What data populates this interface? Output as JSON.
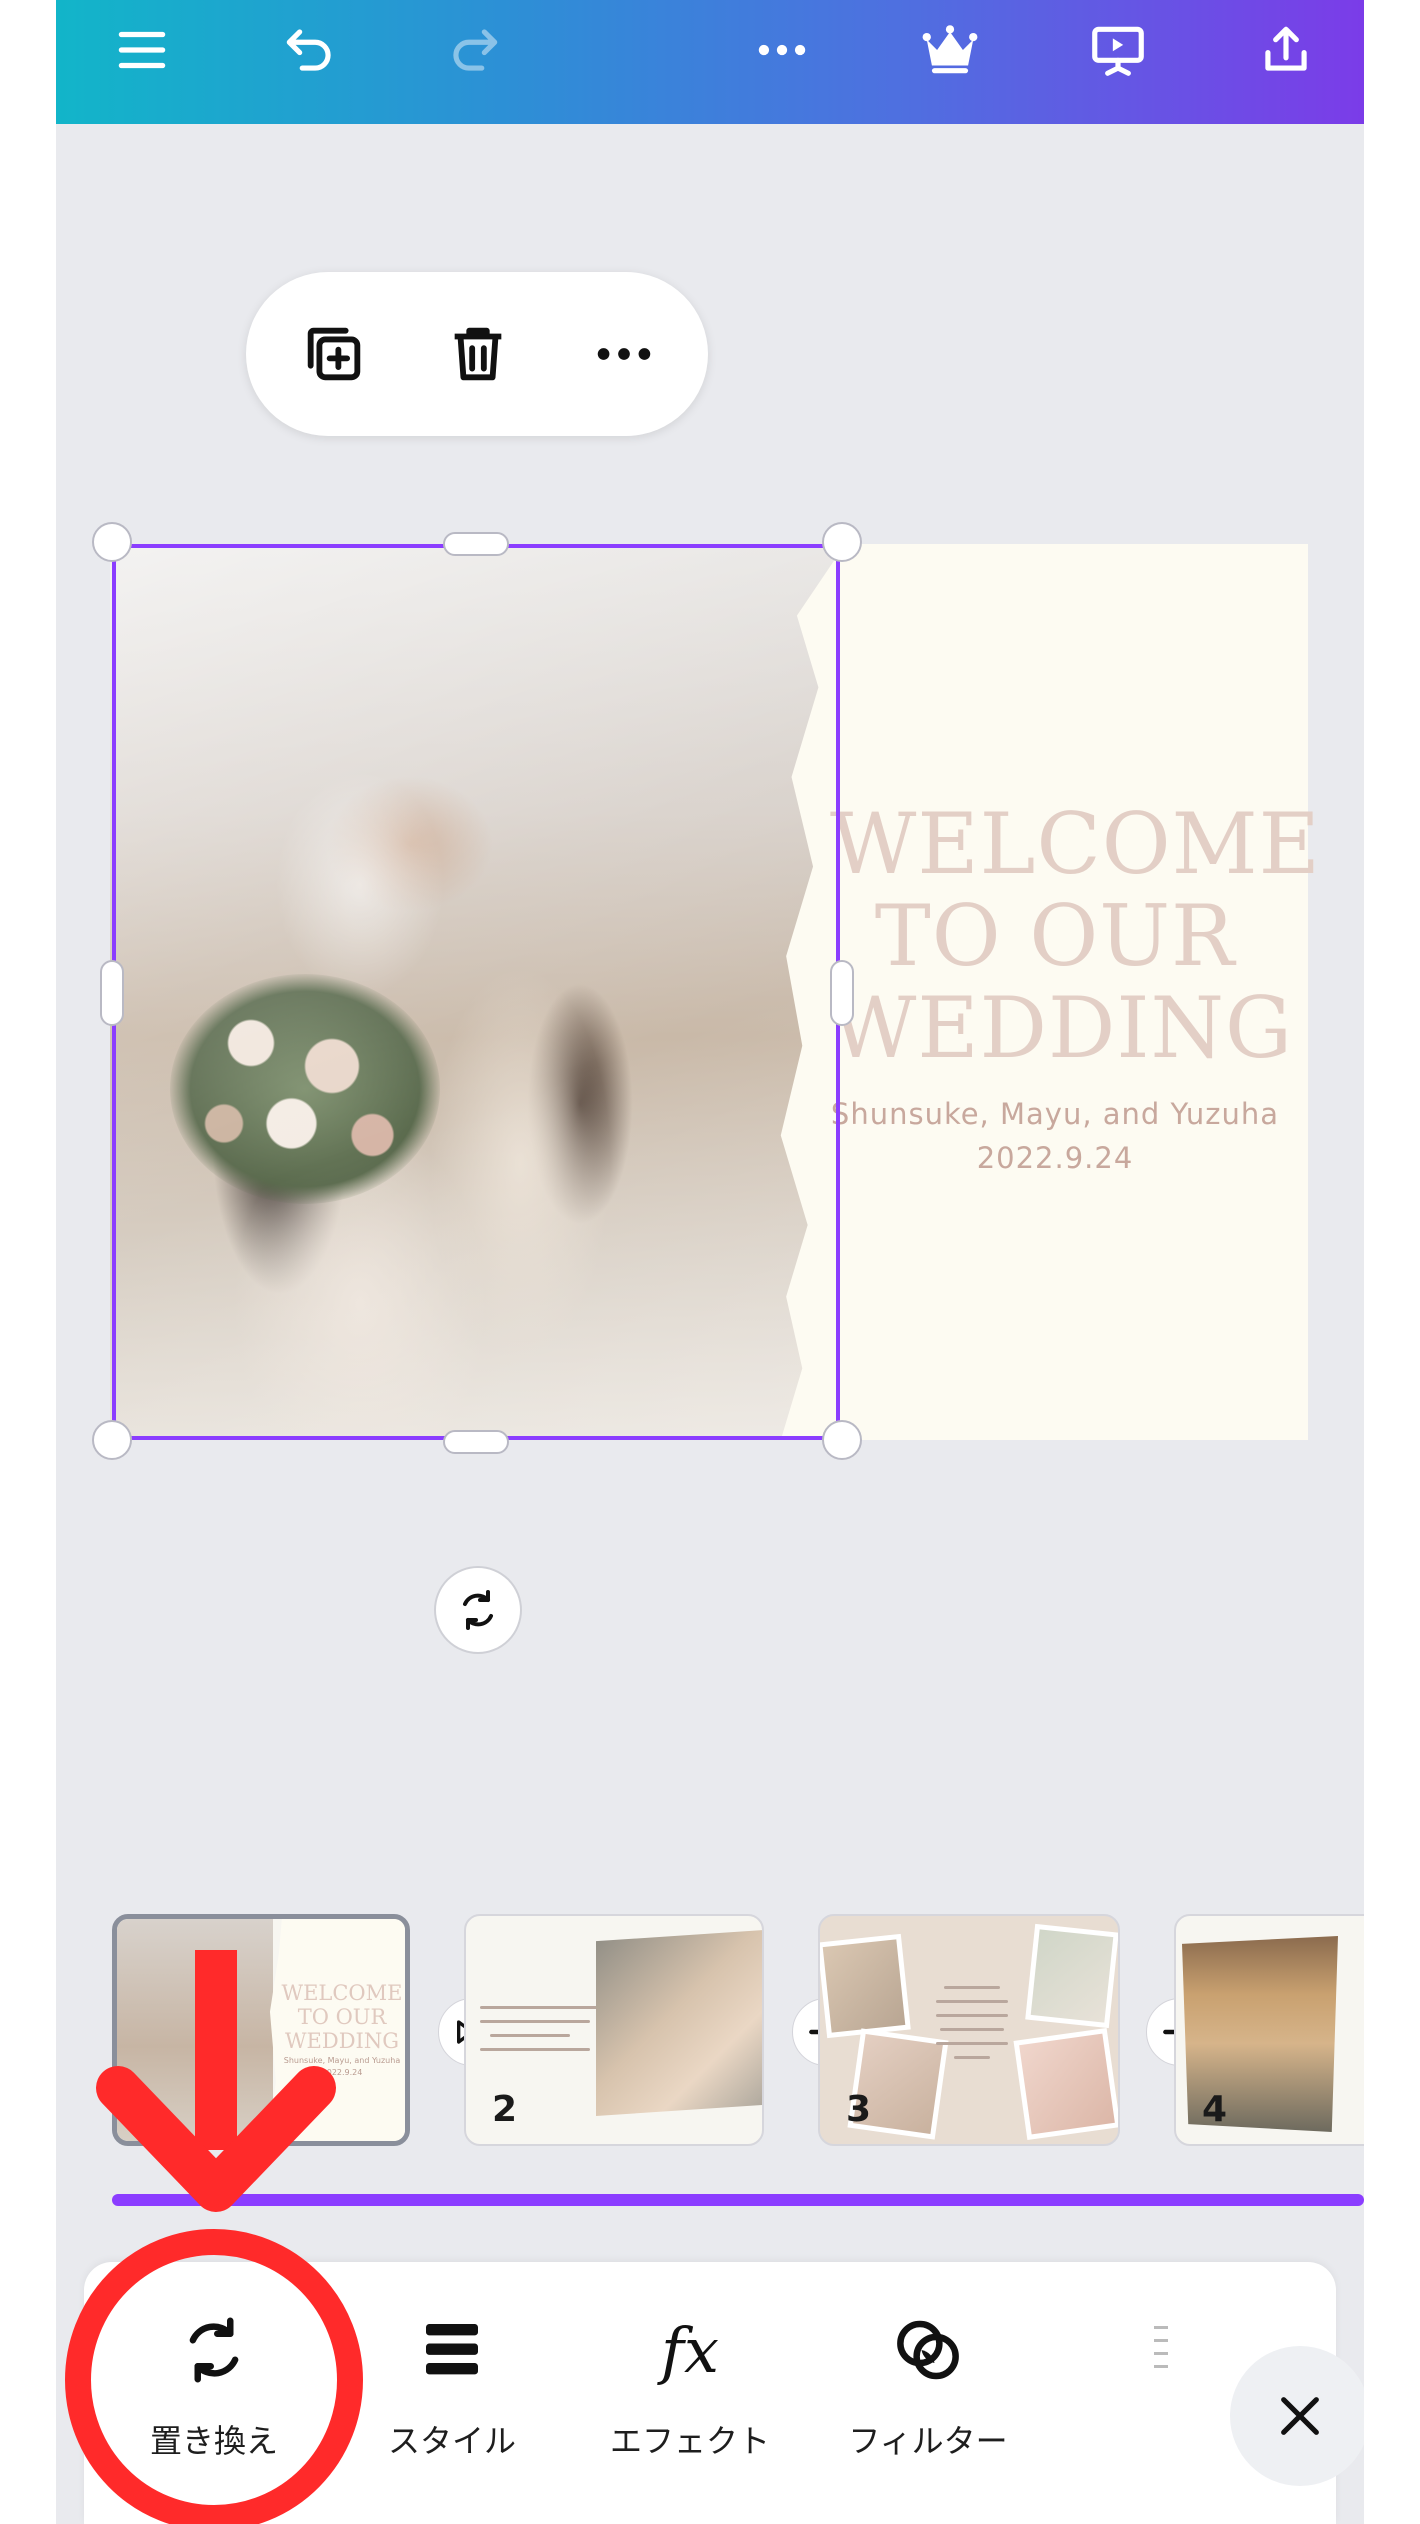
{
  "topbar": {
    "icons": [
      "menu-icon",
      "undo-icon",
      "redo-icon",
      "more-icon",
      "crown-icon",
      "present-icon",
      "share-icon"
    ]
  },
  "floating_toolbar": {
    "icons": [
      "duplicate-icon",
      "trash-icon",
      "more-icon"
    ]
  },
  "page": {
    "welcome_text": "WELCOME TO OUR WEDDING",
    "names": "Shunsuke, Mayu, and Yuzuha",
    "date": "2022.9.24"
  },
  "thumbnails": [
    {
      "number": "",
      "title_mini": "WELCOME TO OUR WEDDING",
      "sub_mini": "Shunsuke, Mayu, and Yuzuha",
      "date_mini": "2022.9.24"
    },
    {
      "number": "2"
    },
    {
      "number": "3"
    },
    {
      "number": "4"
    }
  ],
  "bottom_toolbar": {
    "tools": [
      {
        "label": "置き換え",
        "icon": "replace-icon"
      },
      {
        "label": "スタイル",
        "icon": "style-icon"
      },
      {
        "label": "エフェクト",
        "icon": "effects-icon"
      },
      {
        "label": "フィルター",
        "icon": "filter-icon"
      }
    ],
    "close_icon": "close-icon"
  },
  "colors": {
    "selection": "#8b3dff",
    "annotation": "#ff2a2a",
    "topbar_start": "#12b5c9",
    "topbar_end": "#7b3ce8"
  }
}
